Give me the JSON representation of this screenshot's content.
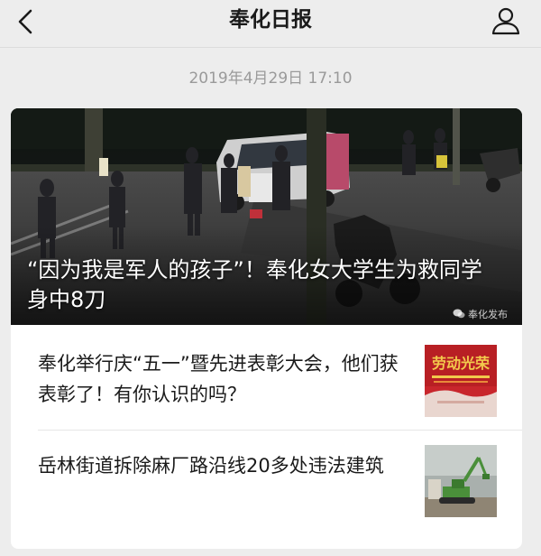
{
  "nav": {
    "title": "奉化日报",
    "back_icon": "chevron-left-icon",
    "profile_icon": "person-icon"
  },
  "timestamp": "2019年4月29日 17:10",
  "hero": {
    "title": "“因为我是军人的孩子”！奉化女大学生为救同学身中8刀",
    "source": "奉化发布",
    "source_icon": "wechat-icon"
  },
  "articles": [
    {
      "title": "奉化举行庆“五一”暨先进表彰大会，他们获表彰了！有你认识的吗？",
      "thumbnail_caption": "劳动光荣"
    },
    {
      "title": "岳林街道拆除麻厂路沿线20多处违法建筑"
    }
  ],
  "colors": {
    "background": "#ededed",
    "card": "#ffffff",
    "text": "#1a1a1a",
    "muted": "#9a9a9a",
    "thumb_red": "#c8262c"
  }
}
